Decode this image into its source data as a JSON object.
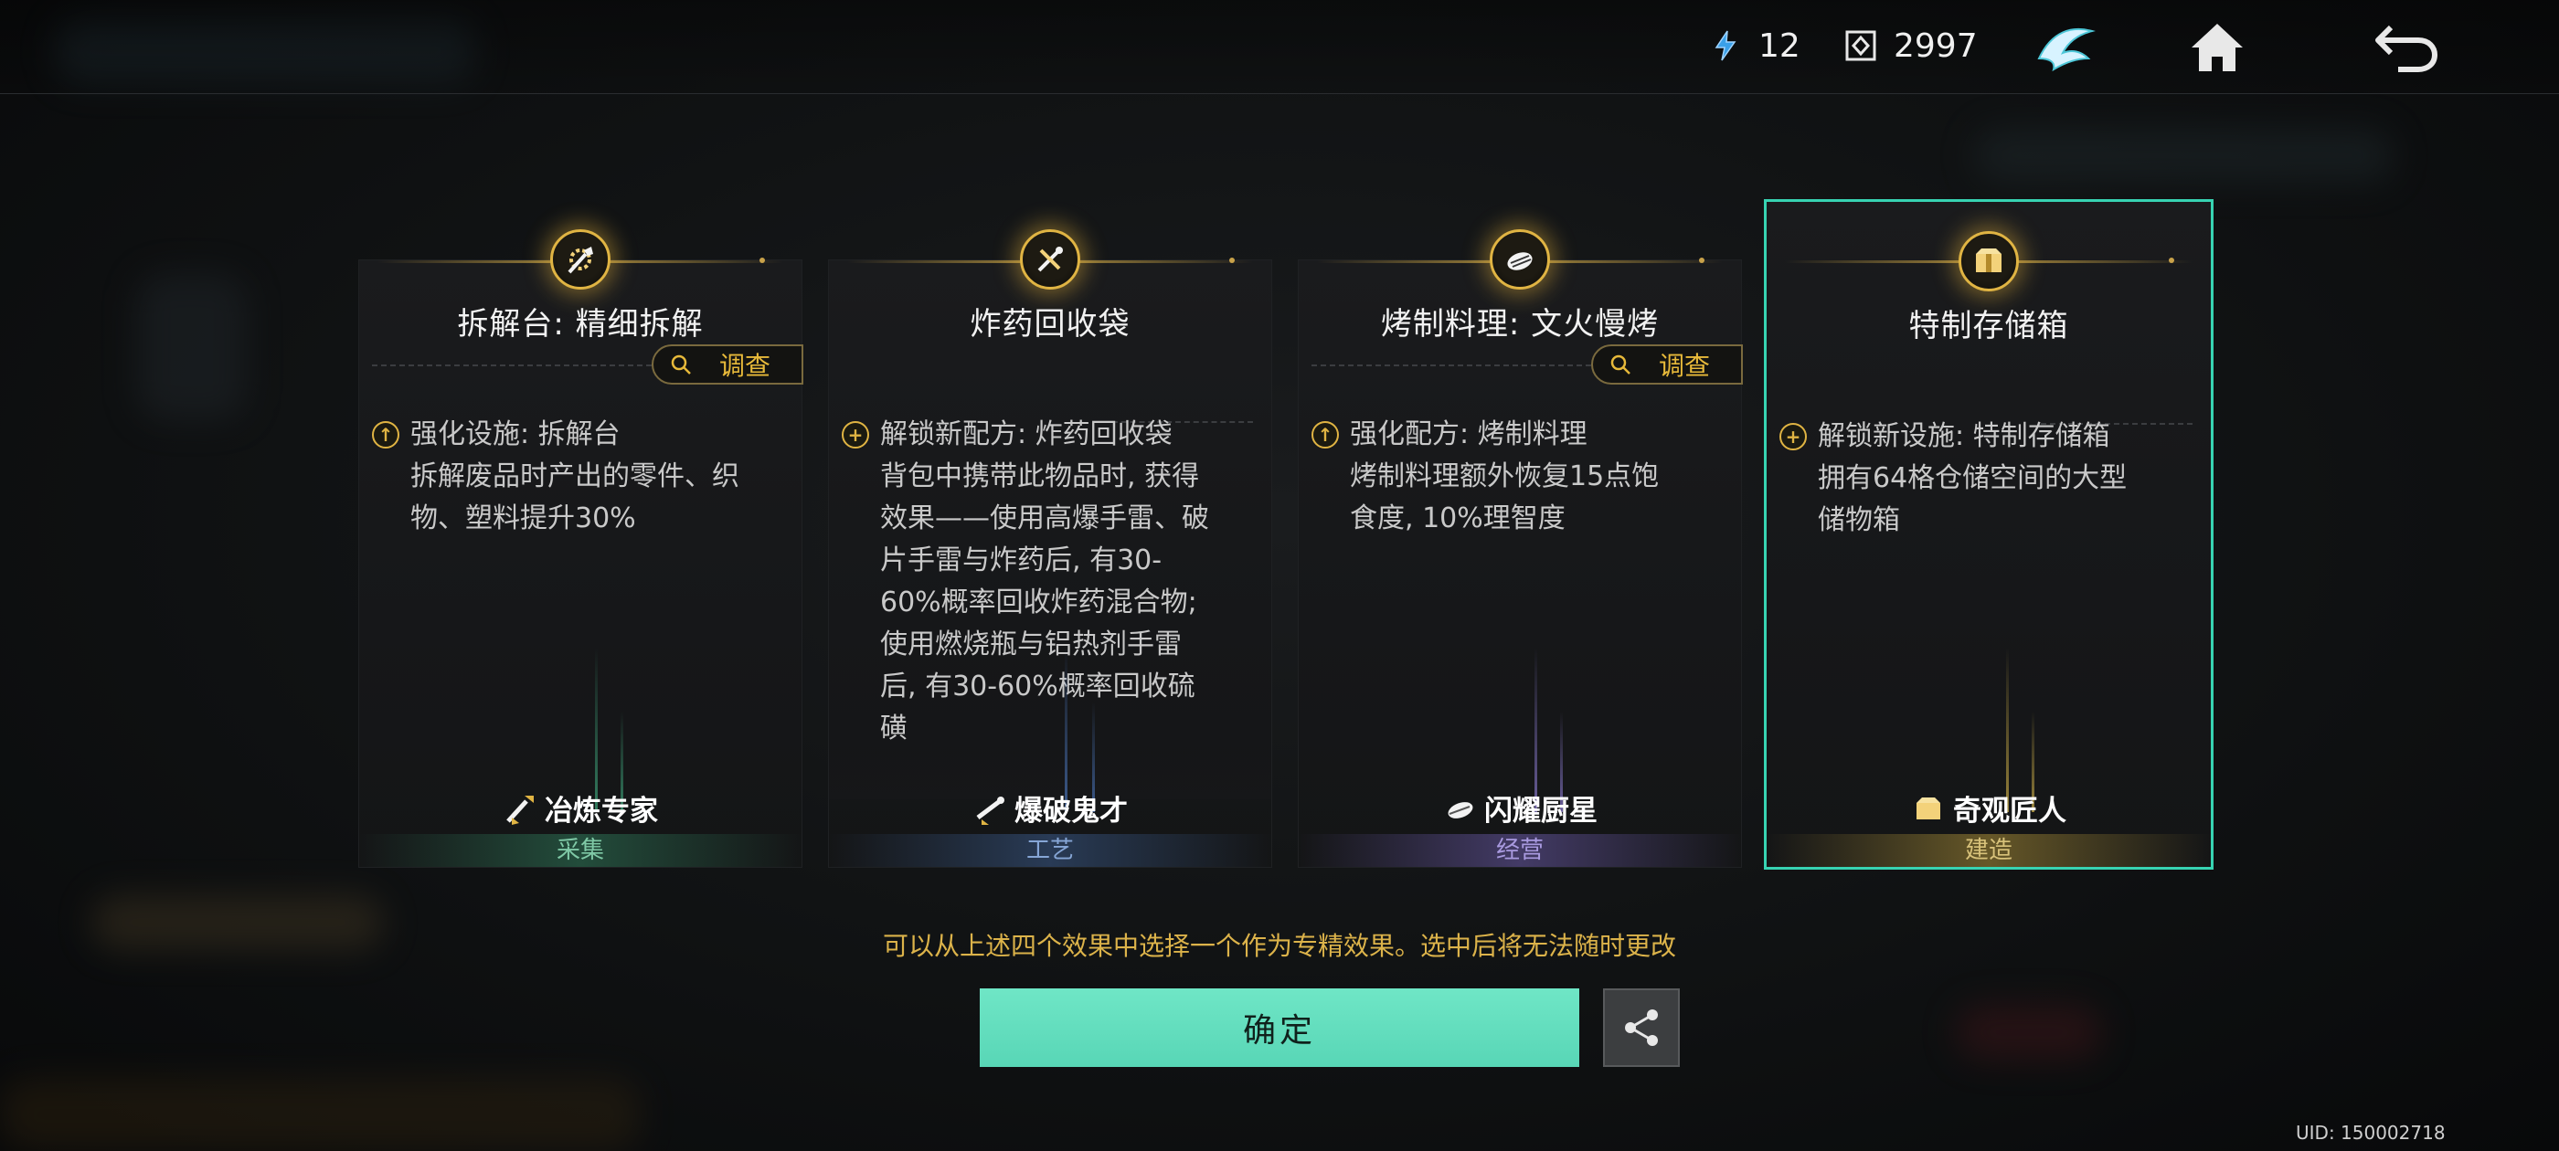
{
  "resources": {
    "energy_count": "12",
    "coin_count": "2997"
  },
  "cards": [
    {
      "title": "拆解台: 精细拆解",
      "investigate_label": "调查",
      "desc_title": "强化设施: 拆解台",
      "desc_lines": [
        "拆解废品时产出的零件、织",
        "物、塑料提升30%"
      ],
      "role": "冶炼专家",
      "category": "采集",
      "accent": "#2f7a5a"
    },
    {
      "title": "炸药回收袋",
      "desc_title": "解锁新配方: 炸药回收袋",
      "desc_lines": [
        "背包中携带此物品时, 获得",
        "效果——使用高爆手雷、破",
        "片手雷与炸药后, 有30-",
        "60%概率回收炸药混合物;",
        "使用燃烧瓶与铝热剂手雷",
        "后, 有30-60%概率回收硫",
        "磺"
      ],
      "role": "爆破鬼才",
      "category": "工艺",
      "accent": "#3a5a8a"
    },
    {
      "title": "烤制料理: 文火慢烤",
      "investigate_label": "调查",
      "desc_title": "强化配方: 烤制料理",
      "desc_lines": [
        "烤制料理额外恢复15点饱",
        "食度, 10%理智度"
      ],
      "role": "闪耀厨星",
      "category": "经营",
      "accent": "#6a5aa8"
    },
    {
      "title": "特制存储箱",
      "desc_title": "解锁新设施: 特制存储箱",
      "desc_lines": [
        "拥有64格仓储空间的大型",
        "储物箱"
      ],
      "role": "奇观匠人",
      "category": "建造",
      "accent": "#b89a3a"
    }
  ],
  "hint": "可以从上述四个效果中选择一个作为专精效果。选中后将无法随时更改",
  "confirm_label": "确定",
  "uid": "UID: 150002718",
  "colors": {
    "selected_border": "#37d3b2",
    "gold": "#e0b443",
    "confirm": "#5fdcbc"
  }
}
